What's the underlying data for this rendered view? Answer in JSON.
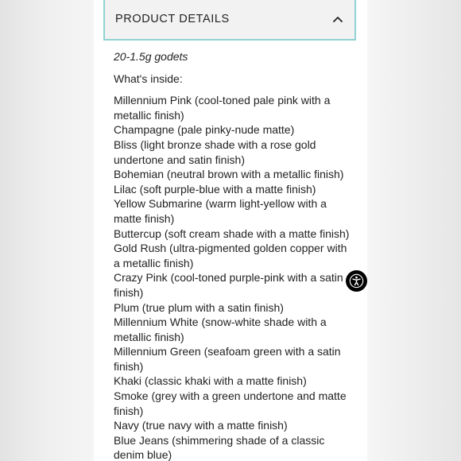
{
  "accordion": {
    "title": "PRODUCT DETAILS",
    "expanded": true,
    "toggle_icon": "chevron-up-icon",
    "border_color": "#8fd3d2"
  },
  "details": {
    "size": "20-1.5g godets",
    "inside_label": "What's inside:",
    "shades": [
      "Millennium Pink (cool-toned pale pink with a metallic finish)",
      "Champagne (pale pinky-nude matte)",
      "Bliss (light bronze shade with a rose gold undertone and satin finish)",
      "Bohemian (neutral brown with a metallic finish)",
      "Lilac (soft purple-blue with a matte finish)",
      "Yellow Submarine (warm light-yellow with a matte finish)",
      "Buttercup (soft cream shade with a matte finish)",
      "Gold Rush (ultra-pigmented golden copper with a metallic finish)",
      "Crazy Pink (cool-toned purple-pink with a satin finish)",
      "Plum (true plum with a satin finish)",
      "Millennium White (snow-white shade with a metallic finish)",
      "Millennium Green (seafoam green with a satin finish)",
      "Khaki (classic khaki with a matte finish)",
      "Smoke (grey with a green undertone and matte finish)",
      "Navy (true navy with a matte finish)",
      "Blue Jeans (shimmering shade of a classic denim blue)"
    ]
  },
  "accessibility": {
    "icon": "accessibility-icon"
  }
}
